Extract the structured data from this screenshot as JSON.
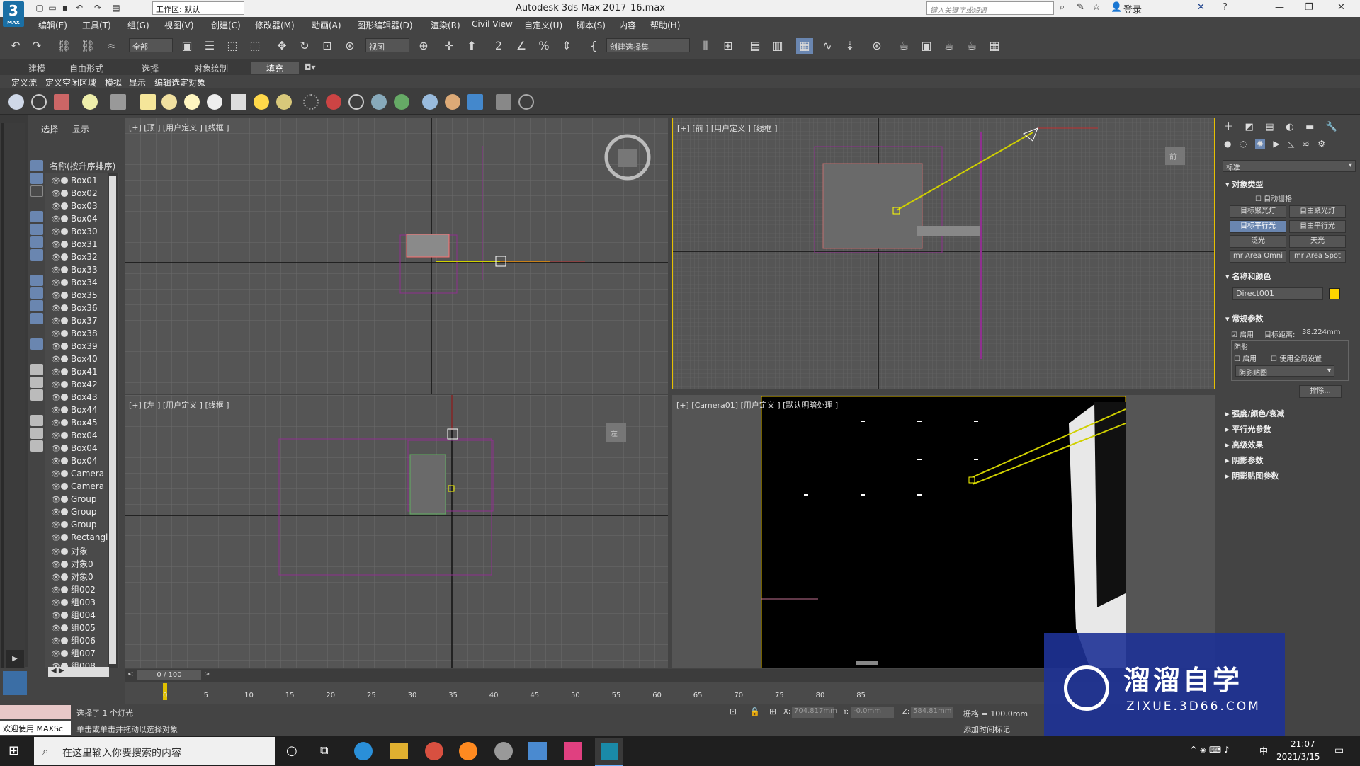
{
  "app": {
    "title": "Autodesk 3ds Max 2017",
    "file": "16.max",
    "logo": "3",
    "logo_sub": "MAX"
  },
  "workspace": {
    "label": "工作区: 默认"
  },
  "search": {
    "placeholder": "键入关键字或短语"
  },
  "login": "登录",
  "menus": [
    "编辑(E)",
    "工具(T)",
    "组(G)",
    "视图(V)",
    "创建(C)",
    "修改器(M)",
    "动画(A)",
    "图形编辑器(D)",
    "渲染(R)",
    "Civil View",
    "自定义(U)",
    "脚本(S)",
    "内容",
    "帮助(H)"
  ],
  "toolbar": {
    "filter": "全部",
    "ref_coord": "视图",
    "selection_set": "创建选择集"
  },
  "ribbon_tabs": [
    "建模",
    "自由形式",
    "选择",
    "对象绘制",
    "填充"
  ],
  "ribbon_subtabs": [
    "定义流",
    "定义空闲区域",
    "模拟",
    "显示",
    "编辑选定对象"
  ],
  "scene": {
    "tabs": [
      "选择",
      "显示"
    ],
    "header": "名称(按升序排序)",
    "items": [
      "Box01",
      "Box02",
      "Box03",
      "Box04",
      "Box30",
      "Box31",
      "Box32",
      "Box33",
      "Box34",
      "Box35",
      "Box36",
      "Box37",
      "Box38",
      "Box39",
      "Box40",
      "Box41",
      "Box42",
      "Box43",
      "Box44",
      "Box45",
      "Box04",
      "Box04",
      "Box04",
      "Camera",
      "Camera",
      "Group",
      "Group",
      "Group",
      "Rectangle",
      "对象",
      "对象0",
      "对象0",
      "组002",
      "组003",
      "组004",
      "组005",
      "组006",
      "组007",
      "组008"
    ]
  },
  "viewports": {
    "top": "[+] [顶 ] [用户定义 ] [线框 ]",
    "front": "[+] [前 ] [用户定义 ] [线框 ]",
    "left": "[+] [左 ] [用户定义 ] [线框 ]",
    "camera": "[+] [Camera01] [用户定义 ] [默认明暗处理 ]",
    "cube_front": "前",
    "cube_left": "左"
  },
  "command_panel": {
    "dropdown": "标准",
    "object_type": "对象类型",
    "autogrid": "自动栅格",
    "buttons": [
      "目标聚光灯",
      "自由聚光灯",
      "目标平行光",
      "自由平行光",
      "泛光",
      "天光",
      "mr Area Omni",
      "mr Area Spot"
    ],
    "name_color": "名称和颜色",
    "object_name": "Direct001",
    "general": "常规参数",
    "enable": "启用",
    "target_dist_label": "目标距离:",
    "target_dist": "38.224mm",
    "shadows": "阴影",
    "shadow_enable": "启用",
    "use_global": "使用全局设置",
    "shadow_map": "阴影贴图",
    "exclude": "排除...",
    "rollouts": [
      "强度/颜色/衰减",
      "平行光参数",
      "高级效果",
      "阴影参数",
      "阴影贴图参数"
    ],
    "accent_color": "#ffd400"
  },
  "timeline": {
    "frame": "0 / 100",
    "ticks": [
      "0",
      "5",
      "10",
      "15",
      "20",
      "25",
      "30",
      "35",
      "40",
      "45",
      "50",
      "55",
      "60",
      "65",
      "70",
      "75",
      "80",
      "85"
    ]
  },
  "status": {
    "maxscript": "欢迎使用 MAXSc",
    "selected": "选择了 1 个灯光",
    "prompt": "单击或单击并拖动以选择对象",
    "x_label": "X:",
    "x": "704.817mm",
    "y_label": "Y:",
    "y": "-0.0mm",
    "z_label": "Z:",
    "z": "584.81mm",
    "grid": "栅格 = 100.0mm",
    "add_time_tag": "添加时间标记"
  },
  "taskbar": {
    "search": "在这里输入你要搜索的内容",
    "time": "21:07",
    "date": "2021/3/15",
    "ime": "中"
  },
  "watermark": {
    "brand": "溜溜自学",
    "url": "ZIXUE.3D66.COM"
  }
}
